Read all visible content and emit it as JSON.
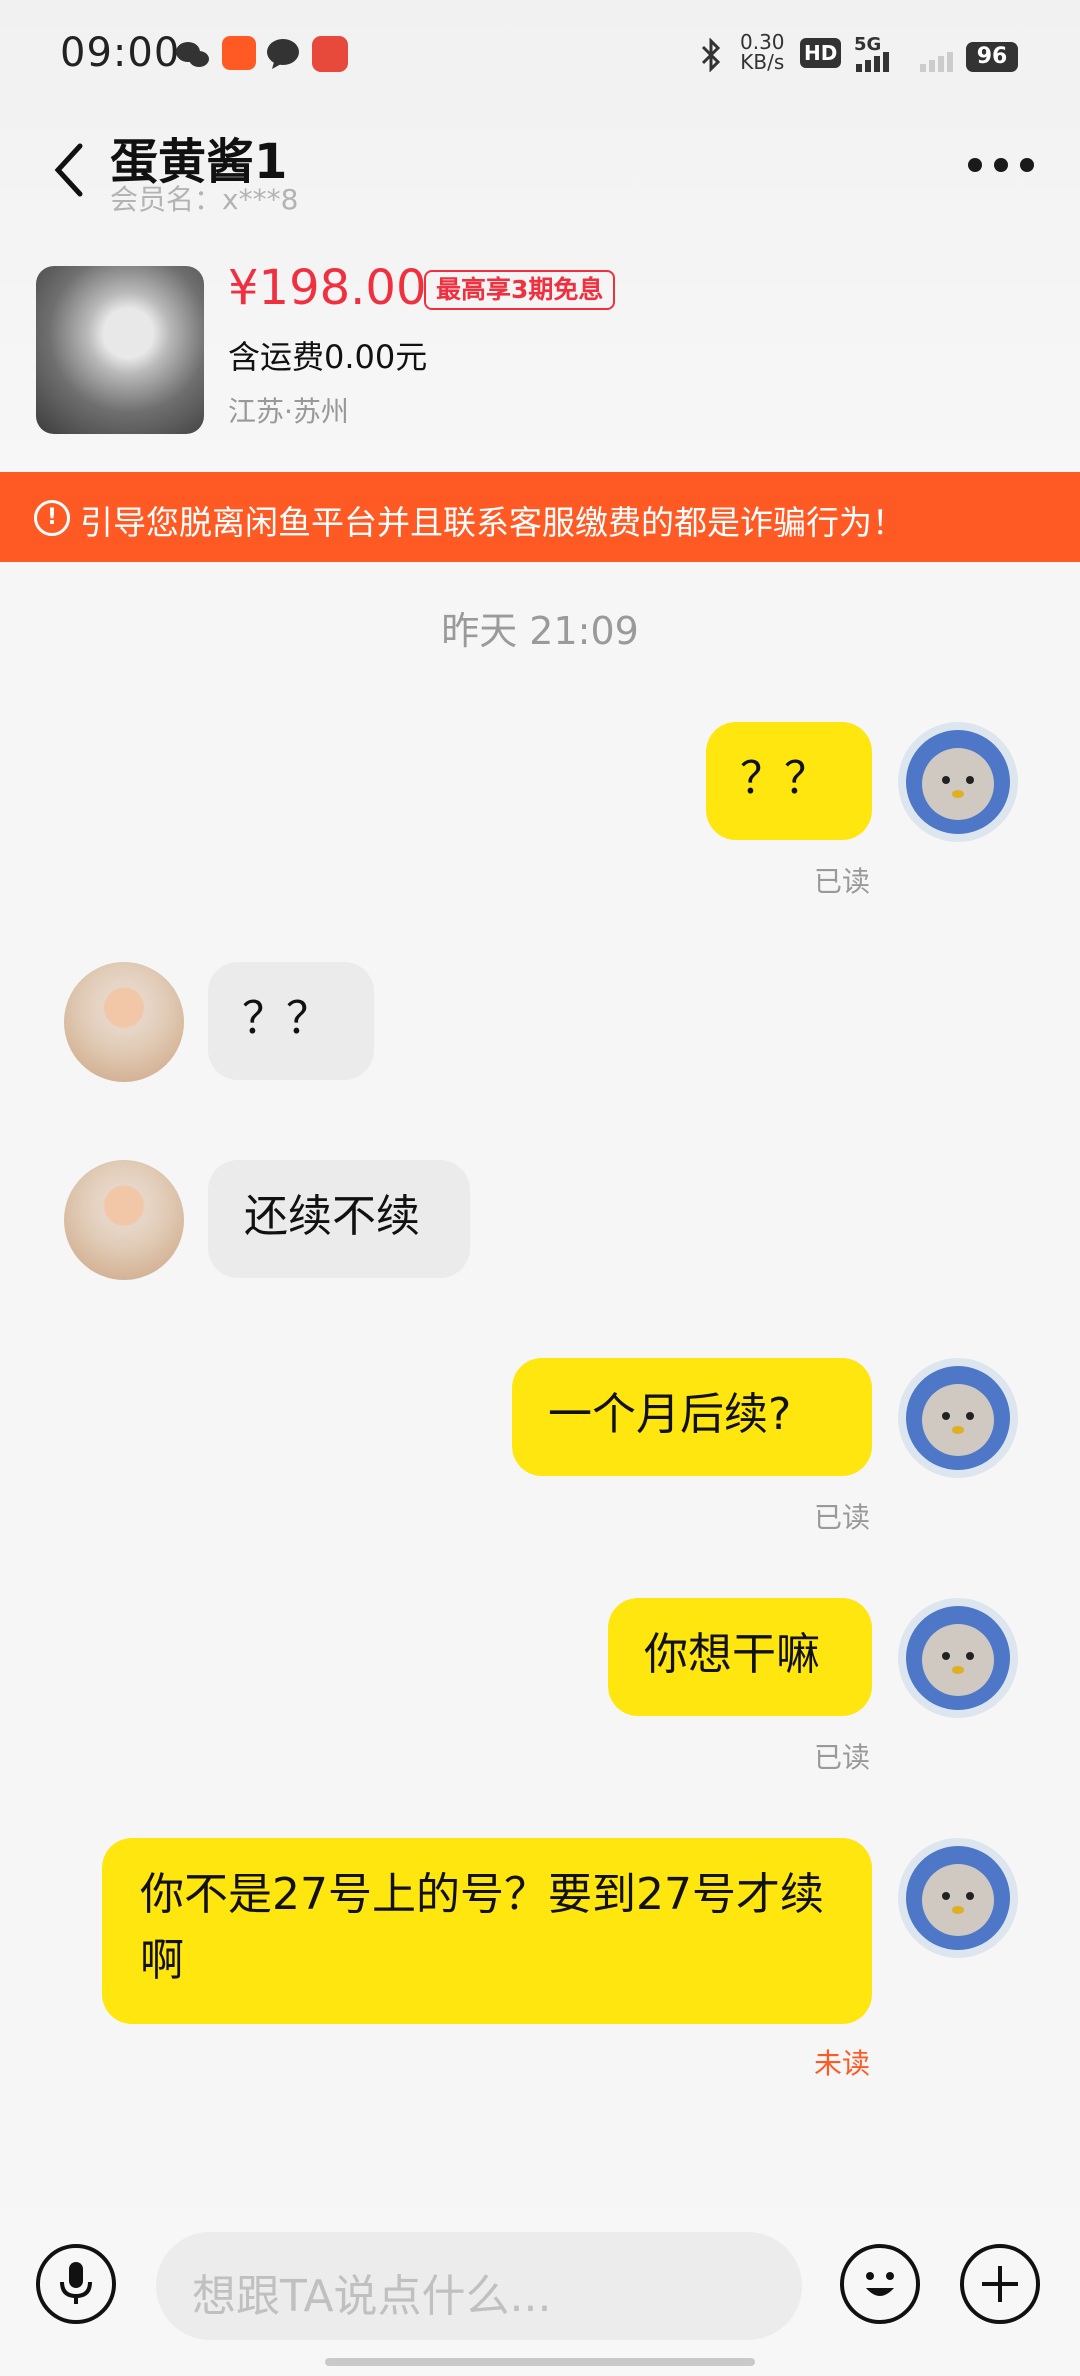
{
  "status_bar": {
    "time": "09:00",
    "net_speed_top": "0.30",
    "net_speed_bottom": "KB/s",
    "hd": "HD",
    "signal": "5G",
    "battery": "96"
  },
  "header": {
    "title": "蛋黄酱1",
    "subtitle": "会员名：x***8"
  },
  "product": {
    "price": "¥198.00",
    "badge": "最高享3期免息",
    "shipping": "含运费0.00元",
    "location": "江苏·苏州"
  },
  "warning": {
    "icon": "!",
    "text": "引导您脱离闲鱼平台并且联系客服缴费的都是诈骗行为！"
  },
  "chat": {
    "timestamp": "昨天 21:09",
    "messages": [
      {
        "sender": "me",
        "text": "？？",
        "status": "已读"
      },
      {
        "sender": "them",
        "text": "？？"
      },
      {
        "sender": "them",
        "text": "还续不续"
      },
      {
        "sender": "me",
        "text": "一个月后续?",
        "status": "已读"
      },
      {
        "sender": "me",
        "text": "你想干嘛",
        "status": "已读"
      },
      {
        "sender": "me",
        "text": "你不是27号上的号？要到27号才续啊",
        "status": "未读"
      }
    ]
  },
  "input": {
    "placeholder": "想跟TA说点什么..."
  },
  "colors": {
    "my_bubble": "#ffe60f",
    "their_bubble": "#ebebeb",
    "price_red": "#f0303f",
    "warning_orange": "#ff5a24"
  },
  "icons": {
    "back": "chevron-left-icon",
    "more": "more-dots-icon",
    "warning": "alert-circle-icon",
    "mic": "microphone-icon",
    "emoji": "emoji-icon",
    "plus": "plus-icon"
  }
}
